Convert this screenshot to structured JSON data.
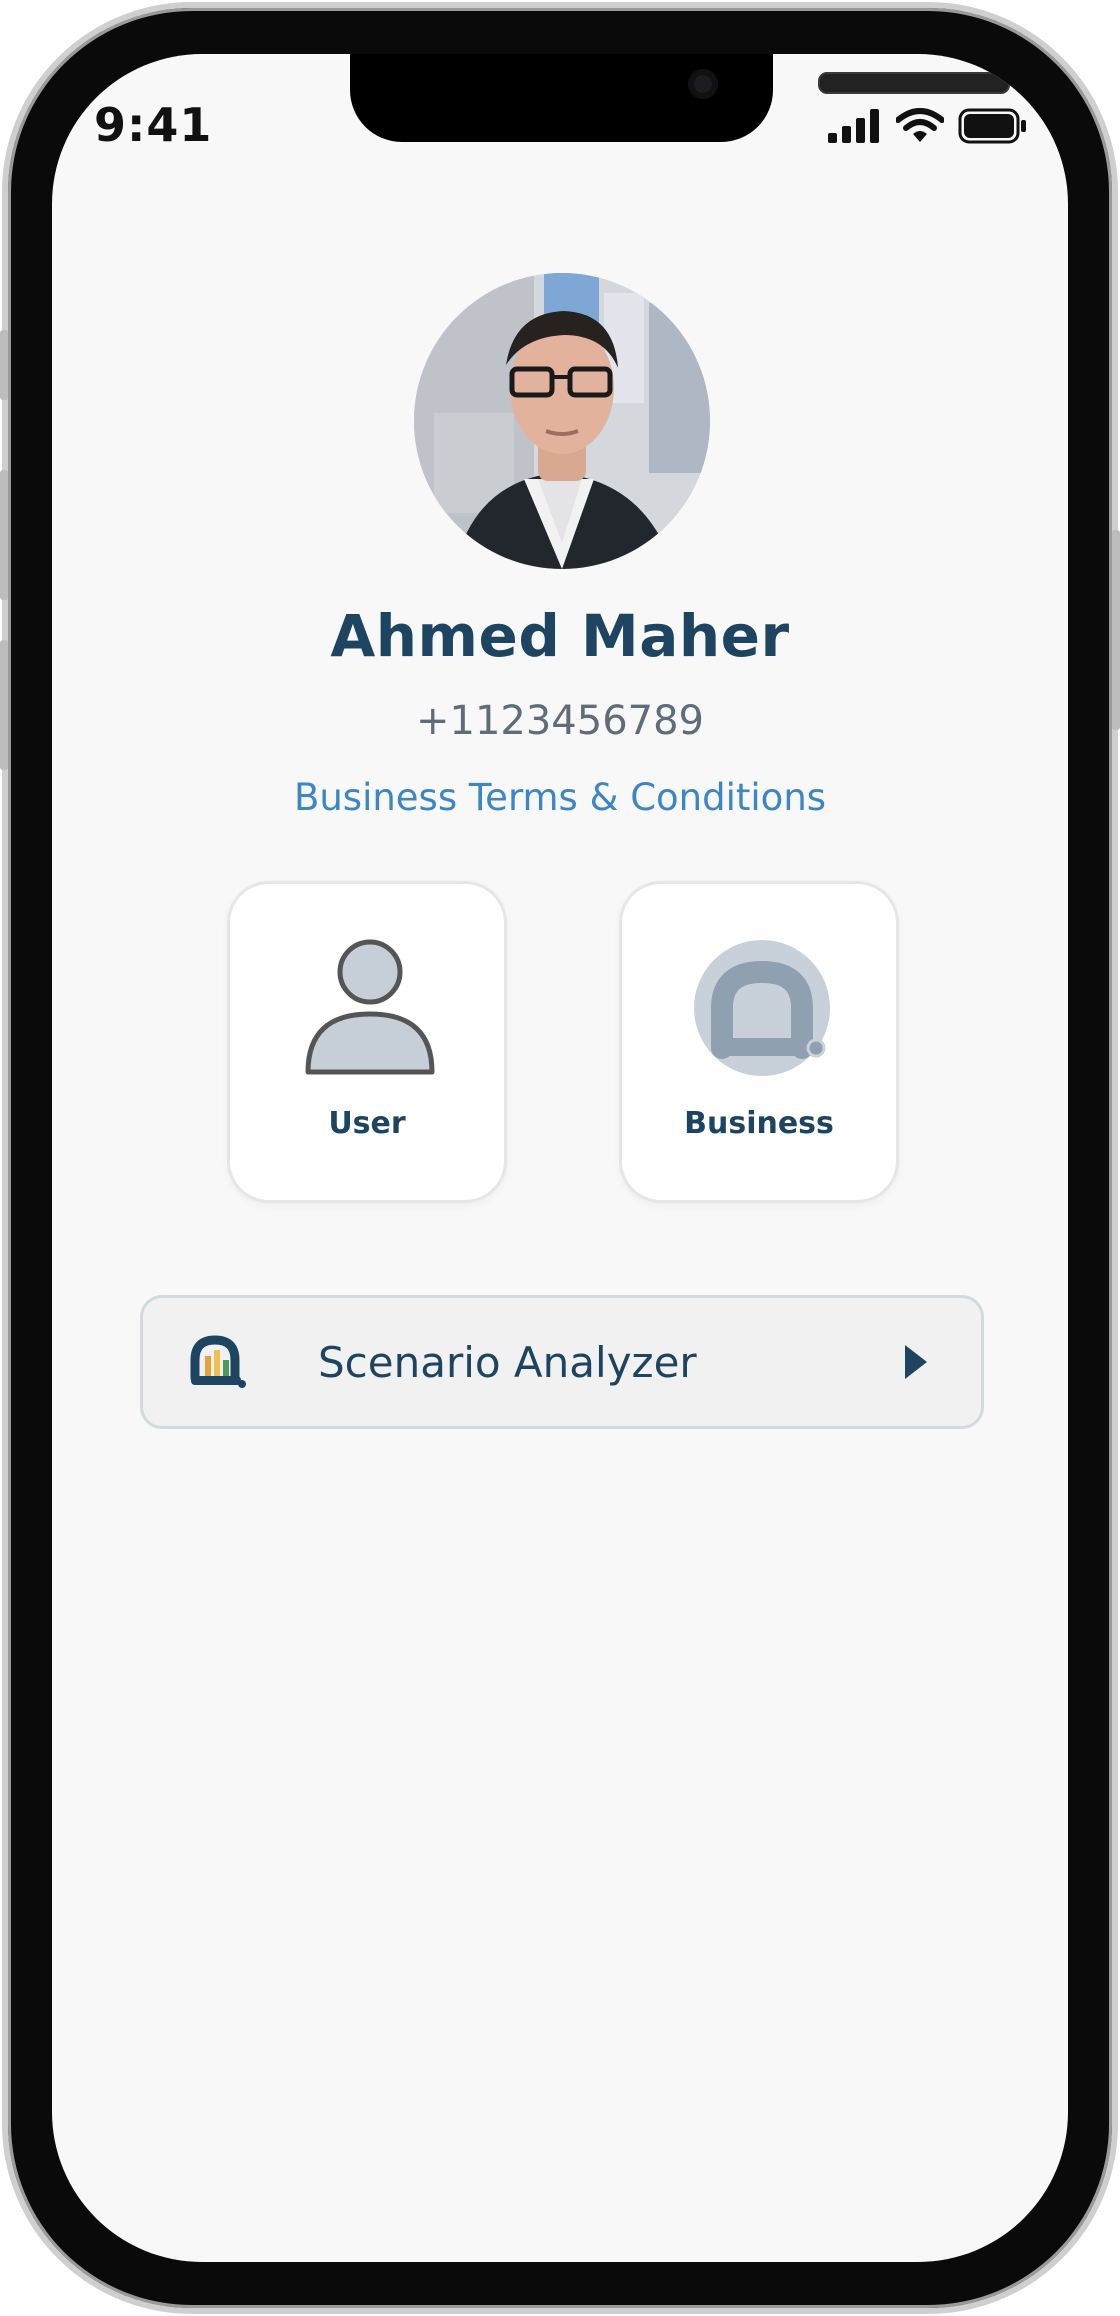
{
  "status_bar": {
    "time": "9:41",
    "icons": [
      "cellular-signal-icon",
      "wifi-icon",
      "battery-icon"
    ]
  },
  "profile": {
    "name": "Ahmed Maher",
    "phone": "+1123456789",
    "terms_link": "Business Terms & Conditions"
  },
  "account_types": [
    {
      "label": "User",
      "icon": "user-icon"
    },
    {
      "label": "Business",
      "icon": "business-icon"
    }
  ],
  "scenario_analyzer": {
    "label": "Scenario Analyzer",
    "icon": "chart-icon",
    "arrow_icon": "play-arrow-icon"
  },
  "colors": {
    "primary": "#1d4461",
    "link": "#3d86c6",
    "secondary_text": "#5f6d7a",
    "background": "#f8f8f8"
  }
}
